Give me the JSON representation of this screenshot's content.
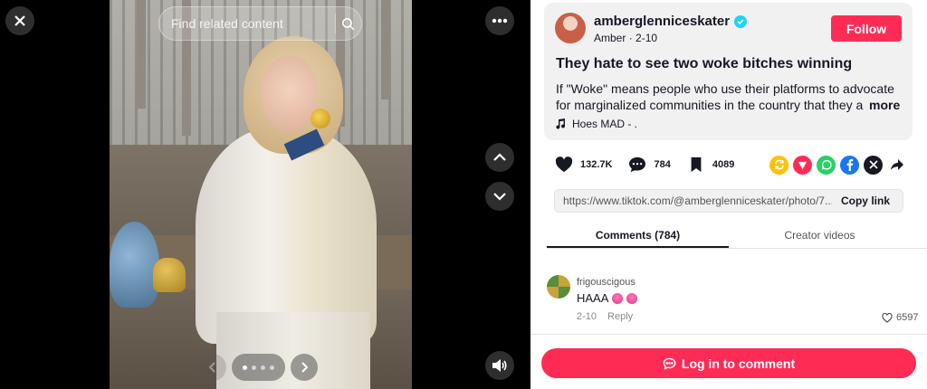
{
  "media": {
    "search": {
      "placeholder": "Find related content"
    },
    "carousel": {
      "count": 4,
      "active_index": 1
    }
  },
  "author": {
    "username": "amberglenniceskater",
    "display_name": "Amber",
    "date": "2-10",
    "follow_label": "Follow"
  },
  "post": {
    "title": "They hate to see two woke bitches winning",
    "description_line1": "If \"Woke\" means people who use their platforms to advocate",
    "description_line2": "for marginalized communities in the country that they a...",
    "more_label": "more",
    "music": "Hoes MAD - ."
  },
  "stats": {
    "likes": "132.7K",
    "comments": "784",
    "saves": "4089"
  },
  "share_icons": [
    "repost-icon",
    "send-icon",
    "whatsapp-icon",
    "facebook-icon",
    "x-icon",
    "share-arrow-icon"
  ],
  "colors": {
    "accent": "#fe2c55",
    "verified": "#20d5ec",
    "whatsapp": "#25d366",
    "facebook": "#1877f2",
    "repost": "#ffc107",
    "send": "#fe2c55"
  },
  "link": {
    "url": "https://www.tiktok.com/@amberglenniceskater/photo/7...",
    "copy_label": "Copy link"
  },
  "tabs": {
    "comments": "Comments (784)",
    "creator_videos": "Creator videos"
  },
  "comment": {
    "user": "frigouscigous",
    "text": "HAAA",
    "date": "2-10",
    "reply_label": "Reply",
    "likes": "6597"
  },
  "login": {
    "label": "Log in to comment"
  }
}
